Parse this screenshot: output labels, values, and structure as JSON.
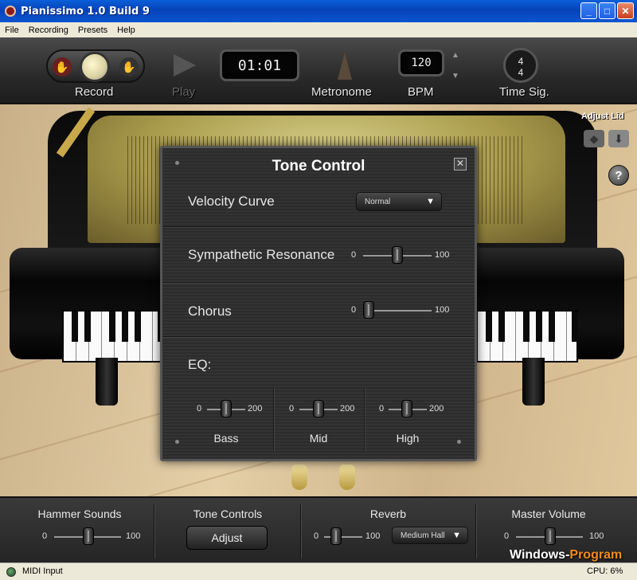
{
  "window": {
    "title": "Pianissimo 1.0 Build 9",
    "minimize": "_",
    "maximize": "□",
    "close": "✕"
  },
  "menu": [
    "File",
    "Recording",
    "Presets",
    "Help"
  ],
  "toolbar": {
    "record_label": "Record",
    "play_label": "Play",
    "time_display": "01:01",
    "metronome_label": "Metronome",
    "bpm_value": "120",
    "bpm_label": "BPM",
    "time_sig_top": "4",
    "time_sig_bottom": "4",
    "time_sig_label": "Time Sig."
  },
  "scene": {
    "adjust_lid_label": "Adjust Lid",
    "help_glyph": "?"
  },
  "tone_control": {
    "title": "Tone Control",
    "close_glyph": "✕",
    "velocity_curve": {
      "label": "Velocity Curve",
      "value": "Normal"
    },
    "sympathetic_resonance": {
      "label": "Sympathetic Resonance",
      "min": "0",
      "max": "100",
      "value": 40
    },
    "chorus": {
      "label": "Chorus",
      "min": "0",
      "max": "100",
      "value": 0
    },
    "eq": {
      "label": "EQ:",
      "bands": [
        {
          "name": "Bass",
          "min": "0",
          "max": "200",
          "value": 100
        },
        {
          "name": "Mid",
          "min": "0",
          "max": "200",
          "value": 100
        },
        {
          "name": "High",
          "min": "0",
          "max": "200",
          "value": 100
        }
      ]
    }
  },
  "bottom_panel": {
    "hammer_sounds": {
      "label": "Hammer Sounds",
      "min": "0",
      "max": "100",
      "value": 55
    },
    "tone_controls": {
      "label": "Tone Controls",
      "button": "Adjust"
    },
    "reverb": {
      "label": "Reverb",
      "min": "0",
      "max": "100",
      "value": 40,
      "preset": "Medium Hall"
    },
    "master_volume": {
      "label": "Master Volume",
      "min": "0",
      "max": "100",
      "value": 55
    }
  },
  "statusbar": {
    "midi_input": "MIDI Input",
    "cpu": "CPU: 6%"
  },
  "watermark": {
    "part1": "Windows-",
    "part2": "Program"
  }
}
